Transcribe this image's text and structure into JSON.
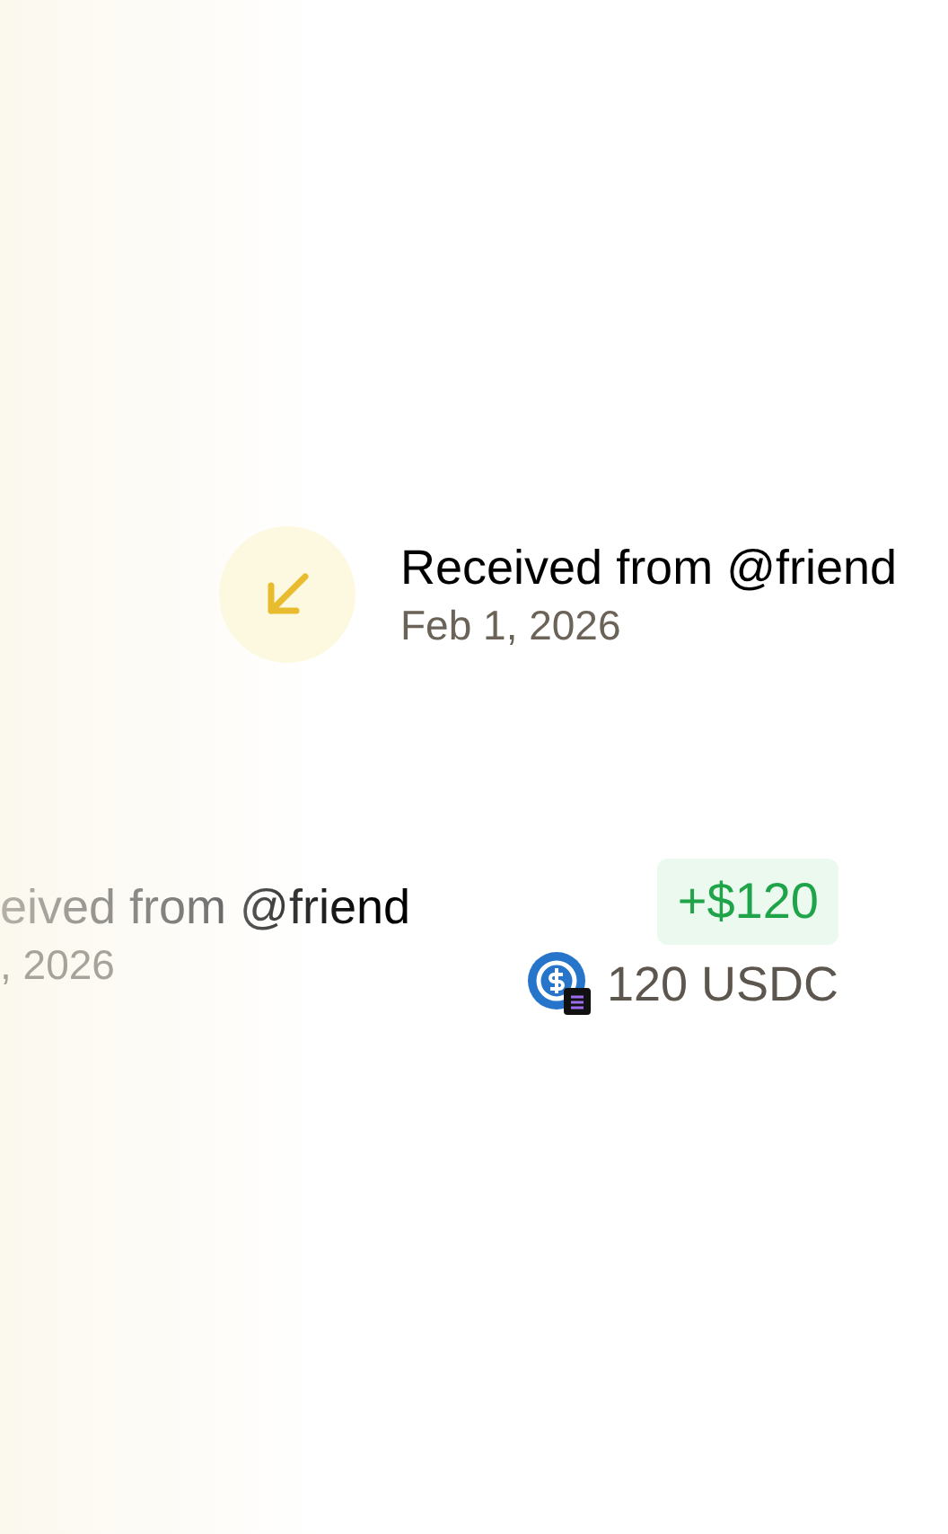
{
  "detail": {
    "title": "Received from @friend",
    "date": "Feb 1, 2026"
  },
  "row": {
    "title": "eived from @friend",
    "date": ", 2026",
    "amount": "+$120",
    "token_amount": "120 USDC"
  }
}
